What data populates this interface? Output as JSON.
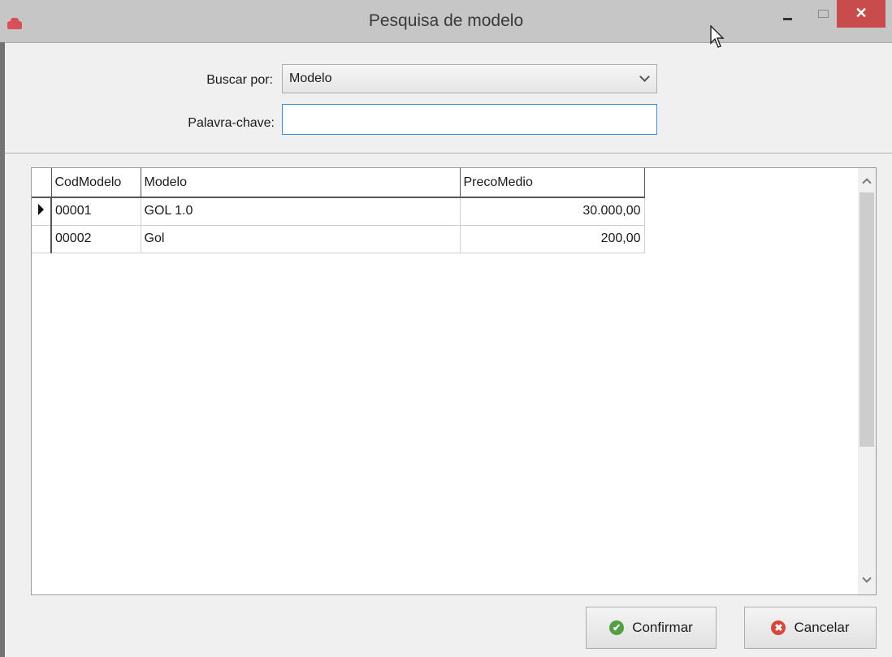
{
  "window": {
    "title": "Pesquisa de modelo",
    "icon": "car-icon",
    "close_glyph": "✕"
  },
  "form": {
    "search_by_label": "Buscar por:",
    "search_by_value": "Modelo",
    "keyword_label": "Palavra-chave:",
    "keyword_value": "",
    "keyword_placeholder": ""
  },
  "grid": {
    "columns": [
      "CodModelo",
      "Modelo",
      "PrecoMedio"
    ],
    "rows": [
      {
        "cod": "00001",
        "modelo": "GOL 1.0",
        "preco": "30.000,00",
        "selected": true
      },
      {
        "cod": "00002",
        "modelo": "Gol",
        "preco": "200,00",
        "selected": false
      }
    ]
  },
  "buttons": {
    "confirm_label": "Confirmar",
    "confirm_icon": "check-circle-icon",
    "confirm_glyph": "✔",
    "cancel_label": "Cancelar",
    "cancel_icon": "x-circle-icon",
    "cancel_glyph": "✖"
  },
  "colors": {
    "close_button": "#c94c4c",
    "confirm_icon": "#55a046",
    "cancel_icon": "#d8483a",
    "input_focus_border": "#3c8fd6"
  }
}
